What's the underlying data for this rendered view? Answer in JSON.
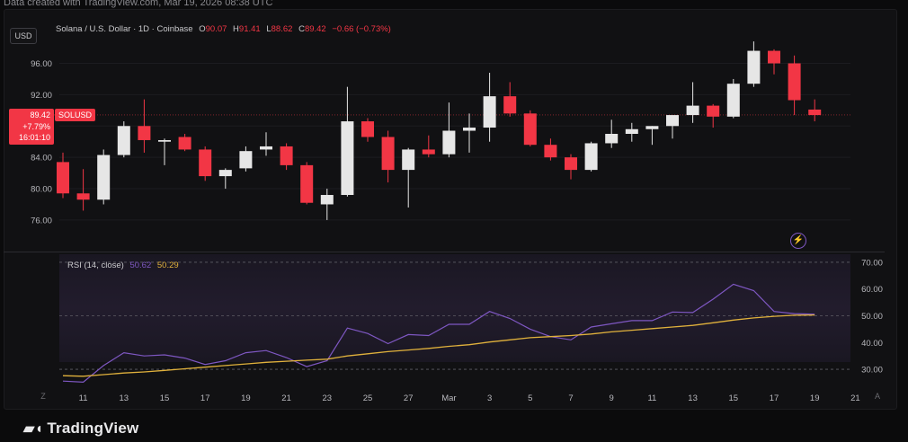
{
  "watermark_text": "Data created with TradingView.com, Mar 19, 2026 08:38 UTC",
  "currency_button": "USD",
  "legend": {
    "symbol_name": "Solana / U.S. Dollar · 1D · Coinbase",
    "open_label": "O",
    "open": "90.07",
    "high_label": "H",
    "high": "91.41",
    "low_label": "L",
    "low": "88.62",
    "close_label": "C",
    "close": "89.42",
    "change": "−0.66 (−0.73%)"
  },
  "price_tag": {
    "price": "89.42",
    "change_pct": "+7.79%",
    "countdown": "16:01:10",
    "symbol": "SOLUSD"
  },
  "rsi_legend": {
    "label": "RSI (14, close)",
    "rsi_value": "50.62",
    "ma_value": "50.29"
  },
  "brand": {
    "logo_icon": "tradingview-logo-icon",
    "name": "TradingView"
  },
  "bottom_buttons": {
    "zoom": "Z",
    "auto": "A"
  },
  "icons": {
    "flash": "lightning-icon"
  },
  "colors": {
    "up": "#e6e6e6",
    "down": "#f23645",
    "rsi_line": "#7e57c2",
    "rsi_ma": "#e0b13c",
    "background": "#111113"
  },
  "chart_data": [
    {
      "type": "candlestick",
      "title": "Solana / U.S. Dollar · 1D · Coinbase",
      "x_ticks": [
        "11",
        "13",
        "15",
        "17",
        "19",
        "21",
        "23",
        "25",
        "27",
        "Mar",
        "3",
        "5",
        "7",
        "9",
        "11",
        "13",
        "15",
        "17",
        "19",
        "21"
      ],
      "y_ticks": [
        76.0,
        80.0,
        84.0,
        88.0,
        92.0,
        96.0
      ],
      "ylim": [
        74.5,
        99.5
      ],
      "dates": [
        "Feb 10",
        "Feb 11",
        "Feb 12",
        "Feb 13",
        "Feb 14",
        "Feb 15",
        "Feb 16",
        "Feb 17",
        "Feb 18",
        "Feb 19",
        "Feb 20",
        "Feb 21",
        "Feb 22",
        "Feb 23",
        "Feb 24",
        "Feb 25",
        "Feb 26",
        "Feb 27",
        "Feb 28",
        "Mar 1",
        "Mar 2",
        "Mar 3",
        "Mar 4",
        "Mar 5",
        "Mar 6",
        "Mar 7",
        "Mar 8",
        "Mar 9",
        "Mar 10",
        "Mar 11",
        "Mar 12",
        "Mar 13",
        "Mar 14",
        "Mar 15",
        "Mar 16",
        "Mar 17",
        "Mar 18",
        "Mar 19"
      ],
      "ohlc": [
        [
          83.4,
          84.6,
          78.8,
          79.4
        ],
        [
          79.4,
          82.5,
          77.2,
          78.6
        ],
        [
          78.6,
          85.0,
          78.0,
          84.3
        ],
        [
          84.3,
          88.6,
          84.0,
          88.0
        ],
        [
          88.0,
          91.4,
          84.6,
          86.2
        ],
        [
          86.0,
          86.4,
          83.0,
          86.2
        ],
        [
          86.6,
          87.0,
          84.8,
          85.0
        ],
        [
          85.0,
          85.4,
          81.0,
          81.6
        ],
        [
          81.6,
          82.6,
          80.0,
          82.4
        ],
        [
          82.6,
          85.4,
          82.2,
          84.8
        ],
        [
          85.0,
          87.2,
          84.2,
          85.4
        ],
        [
          85.4,
          85.8,
          82.4,
          83.0
        ],
        [
          83.0,
          83.4,
          78.0,
          78.2
        ],
        [
          78.0,
          80.0,
          76.0,
          79.2
        ],
        [
          79.2,
          93.0,
          79.0,
          88.6
        ],
        [
          88.6,
          89.0,
          86.0,
          86.6
        ],
        [
          86.6,
          87.4,
          80.8,
          82.4
        ],
        [
          82.4,
          85.2,
          77.6,
          85.0
        ],
        [
          85.0,
          86.8,
          84.0,
          84.4
        ],
        [
          84.4,
          91.0,
          84.0,
          87.4
        ],
        [
          87.4,
          89.6,
          84.6,
          87.8
        ],
        [
          87.8,
          94.8,
          86.0,
          91.8
        ],
        [
          91.8,
          93.6,
          89.2,
          89.6
        ],
        [
          89.6,
          90.0,
          85.4,
          85.6
        ],
        [
          85.6,
          86.4,
          83.6,
          84.0
        ],
        [
          84.0,
          84.4,
          81.2,
          82.4
        ],
        [
          82.4,
          86.0,
          82.2,
          85.8
        ],
        [
          85.8,
          88.8,
          85.2,
          87.0
        ],
        [
          87.0,
          88.4,
          86.0,
          87.6
        ],
        [
          87.6,
          88.0,
          85.6,
          88.0
        ],
        [
          88.0,
          88.8,
          86.4,
          89.4
        ],
        [
          89.4,
          93.6,
          88.4,
          90.6
        ],
        [
          90.6,
          90.8,
          87.8,
          89.2
        ],
        [
          89.2,
          94.0,
          89.0,
          93.4
        ],
        [
          93.4,
          98.8,
          93.0,
          97.6
        ],
        [
          97.6,
          97.8,
          94.6,
          96.0
        ],
        [
          96.0,
          97.0,
          89.4,
          91.3
        ],
        [
          90.1,
          91.4,
          88.6,
          89.4
        ]
      ],
      "last_price": 89.42
    },
    {
      "type": "line",
      "title": "RSI (14, close)",
      "y_ticks": [
        30.0,
        40.0,
        50.0,
        60.0,
        70.0
      ],
      "ylim": [
        27,
        72
      ],
      "bands": [
        30,
        50,
        70
      ],
      "series": [
        {
          "name": "RSI",
          "values": [
            25.6,
            25.2,
            31.4,
            36.2,
            35.0,
            35.4,
            34.2,
            31.8,
            33.2,
            36.2,
            37.0,
            34.4,
            31.0,
            33.2,
            45.4,
            43.4,
            39.6,
            43.0,
            42.6,
            46.8,
            46.8,
            51.6,
            49.0,
            45.0,
            42.2,
            41.0,
            45.8,
            47.0,
            48.2,
            48.2,
            51.4,
            51.2,
            56.2,
            61.8,
            59.4,
            51.6,
            50.8,
            50.6
          ]
        },
        {
          "name": "RSI-based MA",
          "values": [
            27.6,
            27.4,
            28.0,
            28.6,
            29.0,
            29.6,
            30.2,
            30.8,
            31.4,
            32.0,
            32.6,
            33.0,
            33.4,
            33.8,
            35.0,
            35.8,
            36.6,
            37.2,
            37.8,
            38.6,
            39.2,
            40.2,
            41.0,
            41.8,
            42.2,
            42.6,
            43.2,
            44.0,
            44.6,
            45.2,
            45.8,
            46.4,
            47.4,
            48.4,
            49.2,
            49.8,
            50.2,
            50.3
          ]
        }
      ]
    }
  ]
}
